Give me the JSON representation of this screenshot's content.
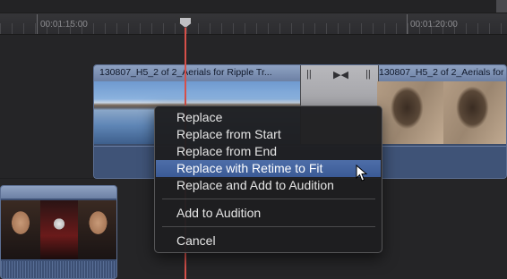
{
  "ruler": {
    "timecodes": [
      "00:01:15:00",
      "00:01:20:00"
    ]
  },
  "clip": {
    "left_title": "130807_H5_2 of 2_Aerials for Ripple Tr...",
    "right_title": "130807_H5_2 of 2_Aerials for"
  },
  "menu": {
    "items": [
      "Replace",
      "Replace from Start",
      "Replace from End",
      "Replace with Retime to Fit",
      "Replace and Add to Audition",
      "Add to Audition",
      "Cancel"
    ],
    "highlighted": "Replace with Retime to Fit"
  },
  "colors": {
    "playhead": "#d6504a",
    "highlight": "#4e6ea8",
    "clip_header": "#8fa2c2",
    "clip_body": "#3b4c6a"
  }
}
